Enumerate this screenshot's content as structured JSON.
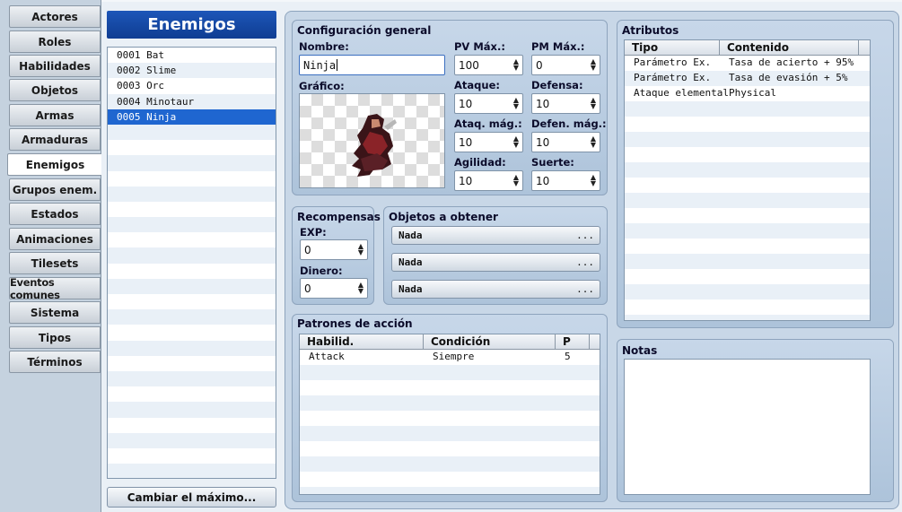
{
  "sidebar": {
    "tabs": [
      "Actores",
      "Roles",
      "Habilidades",
      "Objetos",
      "Armas",
      "Armaduras",
      "Enemigos",
      "Grupos enem.",
      "Estados",
      "Animaciones",
      "Tilesets",
      "Eventos comunes",
      "Sistema",
      "Tipos",
      "Términos"
    ],
    "active_index": 6
  },
  "enemies": {
    "header": "Enemigos",
    "items": [
      "0001 Bat",
      "0002 Slime",
      "0003 Orc",
      "0004 Minotaur",
      "0005 Ninja"
    ],
    "selected_index": 4,
    "change_max_label": "Cambiar el máximo..."
  },
  "general": {
    "title": "Configuración general",
    "name_label": "Nombre:",
    "name_value": "Ninja",
    "graphic_label": "Gráfico:",
    "stats": [
      {
        "label": "PV Máx.:",
        "value": "100"
      },
      {
        "label": "PM Máx.:",
        "value": "0"
      },
      {
        "label": "Ataque:",
        "value": "10"
      },
      {
        "label": "Defensa:",
        "value": "10"
      },
      {
        "label": "Ataq. mág.:",
        "value": "10"
      },
      {
        "label": "Defen. mág.:",
        "value": "10"
      },
      {
        "label": "Agilidad:",
        "value": "10"
      },
      {
        "label": "Suerte:",
        "value": "10"
      }
    ]
  },
  "rewards": {
    "title": "Recompensas",
    "exp_label": "EXP:",
    "exp_value": "0",
    "gold_label": "Dinero:",
    "gold_value": "0"
  },
  "drops": {
    "title": "Objetos a obtener",
    "items": [
      "Nada",
      "Nada",
      "Nada"
    ],
    "dots": "..."
  },
  "actions": {
    "title": "Patrones de acción",
    "columns": [
      "Habilid.",
      "Condición",
      "P"
    ],
    "rows": [
      [
        "Attack",
        "Siempre",
        "5"
      ]
    ]
  },
  "traits": {
    "title": "Atributos",
    "columns": [
      "Tipo",
      "Contenido"
    ],
    "rows": [
      [
        "Parámetro Ex.",
        "Tasa de acierto + 95%"
      ],
      [
        "Parámetro Ex.",
        "Tasa de evasión + 5%"
      ],
      [
        "Ataque elemental",
        "Physical"
      ]
    ]
  },
  "notes": {
    "title": "Notas",
    "value": ""
  },
  "icons": {
    "spin": "spin-arrows-icon",
    "more": "ellipsis-icon"
  }
}
